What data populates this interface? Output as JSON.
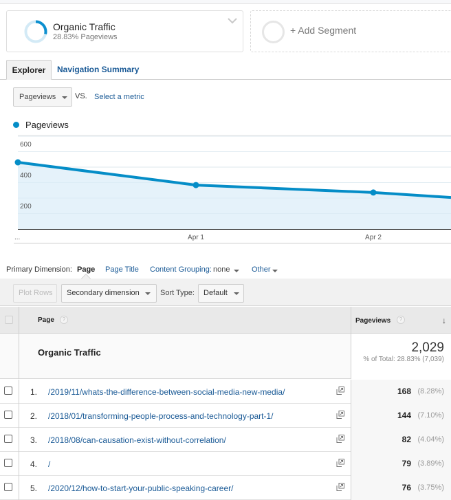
{
  "segments": {
    "active": {
      "title": "Organic Traffic",
      "subtitle": "28.83% Pageviews",
      "share": 0.2883,
      "color": "#0b8fcf",
      "track_color": "#d3eaf6"
    },
    "add_label": "+ Add Segment"
  },
  "tabs": [
    {
      "label": "Explorer",
      "active": true
    },
    {
      "label": "Navigation Summary",
      "active": false
    }
  ],
  "metric_controls": {
    "primary_metric": "Pageviews",
    "vs_label": "VS.",
    "select_metric_label": "Select a metric"
  },
  "chart_data": {
    "type": "area",
    "legend": [
      "Pageviews"
    ],
    "legend_position": "top-left",
    "series": [
      {
        "name": "Pageviews",
        "color": "#058dc7",
        "values": [
          431,
          284,
          236,
          204
        ]
      }
    ],
    "x": [
      "...",
      "Apr 1",
      "Apr 2",
      ""
    ],
    "x_tick_labels": [
      "...",
      "Apr 1",
      "Apr 2"
    ],
    "y_tick_labels": [
      "600",
      "400",
      "200"
    ],
    "ylim": [
      0,
      600
    ],
    "grid": true,
    "title": "",
    "xlabel": "",
    "ylabel": ""
  },
  "dimensions": {
    "label": "Primary Dimension:",
    "active": "Page",
    "page_title": "Page Title",
    "content_grouping_label": "Content Grouping:",
    "content_grouping_value": "none",
    "other": "Other"
  },
  "toolbar": {
    "plot_rows": "Plot Rows",
    "secondary_dimension": "Secondary dimension",
    "sort_type_label": "Sort Type:",
    "sort_type_value": "Default"
  },
  "table": {
    "columns": {
      "page": "Page",
      "pageviews": "Pageviews"
    },
    "help_glyph": "?",
    "sort_glyph": "↓",
    "total": {
      "label": "Organic Traffic",
      "value": "2,029",
      "sub": "% of Total: 28.83% (7,039)"
    },
    "rows": [
      {
        "num": "1.",
        "page": "/2019/11/whats-the-difference-between-social-media-new-media/",
        "pageviews": "168",
        "pct": "(8.28%)"
      },
      {
        "num": "2.",
        "page": "/2018/01/transforming-people-process-and-technology-part-1/",
        "pageviews": "144",
        "pct": "(7.10%)"
      },
      {
        "num": "3.",
        "page": "/2018/08/can-causation-exist-without-correlation/",
        "pageviews": "82",
        "pct": "(4.04%)"
      },
      {
        "num": "4.",
        "page": "/",
        "pageviews": "79",
        "pct": "(3.89%)"
      },
      {
        "num": "5.",
        "page": "/2020/12/how-to-start-your-public-speaking-career/",
        "pageviews": "76",
        "pct": "(3.75%)"
      }
    ]
  }
}
